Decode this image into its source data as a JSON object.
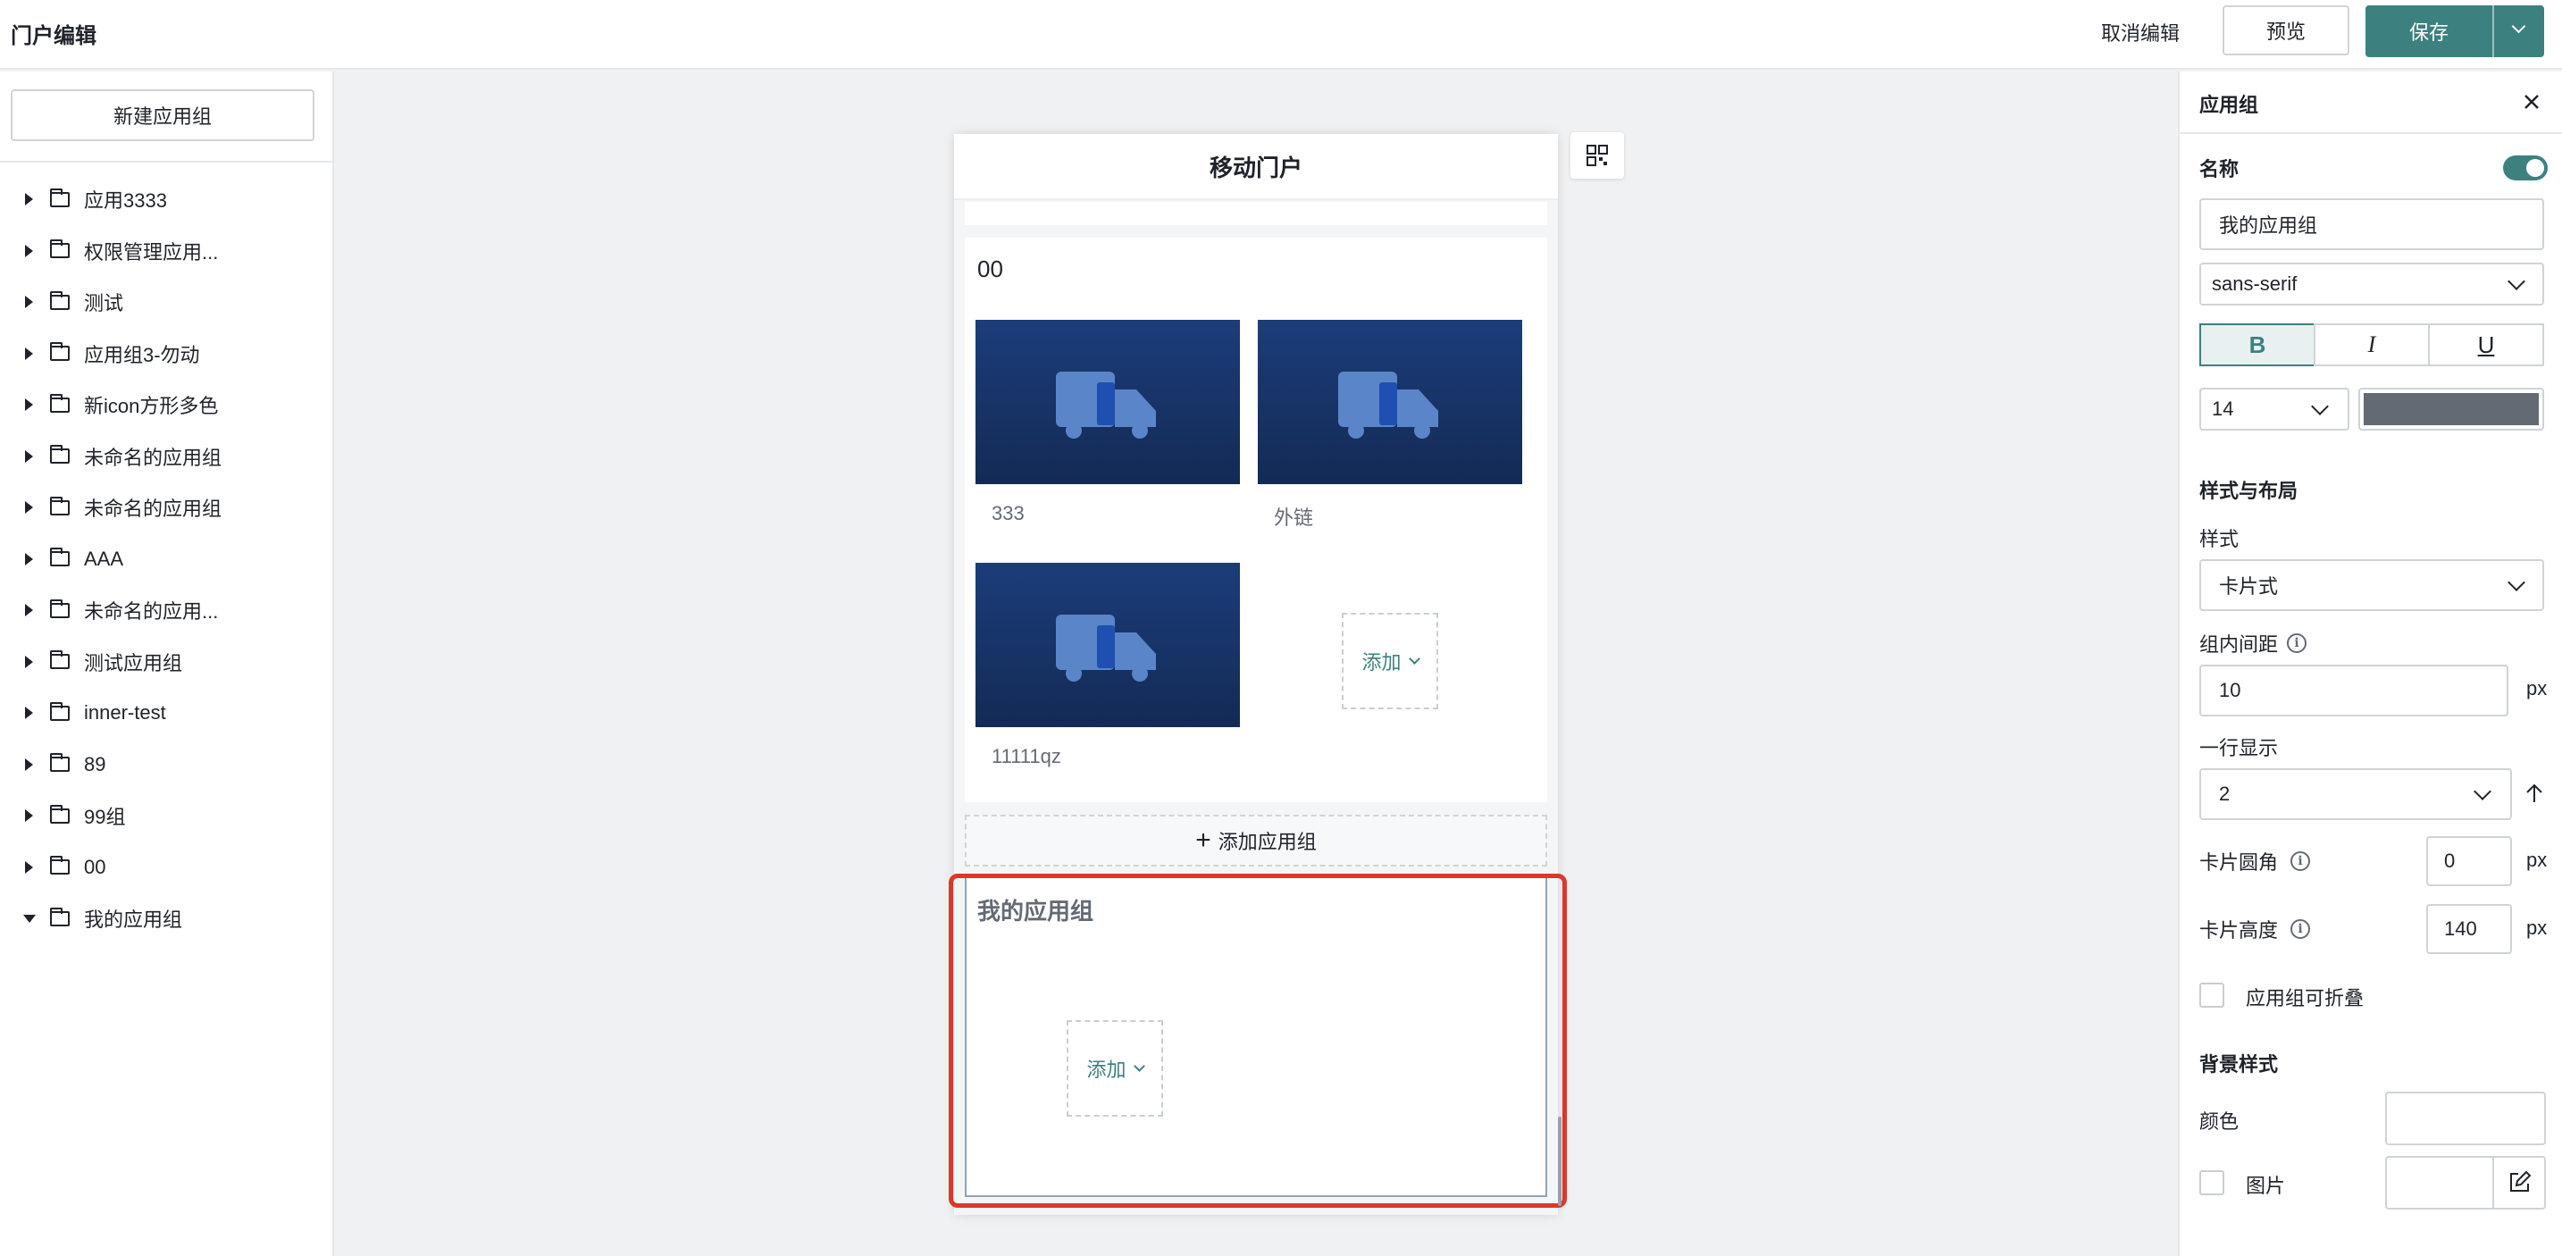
{
  "header": {
    "title": "门户编辑",
    "cancel_label": "取消编辑",
    "preview_label": "预览",
    "save_label": "保存"
  },
  "sidebar": {
    "new_group_label": "新建应用组",
    "items": [
      {
        "label": "应用3333",
        "expanded": false
      },
      {
        "label": "权限管理应用...",
        "expanded": false
      },
      {
        "label": "测试",
        "expanded": false
      },
      {
        "label": "应用组3-勿动",
        "expanded": false
      },
      {
        "label": "新icon方形多色",
        "expanded": false
      },
      {
        "label": "未命名的应用组",
        "expanded": false
      },
      {
        "label": "未命名的应用组",
        "expanded": false
      },
      {
        "label": "AAA",
        "expanded": false
      },
      {
        "label": "未命名的应用...",
        "expanded": false
      },
      {
        "label": "测试应用组",
        "expanded": false
      },
      {
        "label": "inner-test",
        "expanded": false
      },
      {
        "label": "89",
        "expanded": false
      },
      {
        "label": "99组",
        "expanded": false
      },
      {
        "label": "00",
        "expanded": false
      },
      {
        "label": "我的应用组",
        "expanded": true
      }
    ]
  },
  "canvas": {
    "phone_title": "移动门户",
    "group1": {
      "name": "00",
      "apps": [
        {
          "name": "333",
          "icon": "truck-icon"
        },
        {
          "name": "外链",
          "icon": "truck-icon"
        },
        {
          "name": "11111qz",
          "icon": "truck-icon"
        }
      ],
      "add_label": "添加"
    },
    "add_group_label": "添加应用组",
    "selected_group": {
      "name": "我的应用组",
      "add_label": "添加"
    }
  },
  "panel": {
    "title": "应用组",
    "name_label": "名称",
    "name_toggle_on": true,
    "name_value": "我的应用组",
    "font_family": "sans-serif",
    "bold_label": "B",
    "italic_label": "I",
    "underline_label": "U",
    "font_size": "14",
    "text_color": "#646a73",
    "section_style_layout": "样式与布局",
    "style_label": "样式",
    "style_value": "卡片式",
    "gap_label": "组内间距",
    "gap_value": "10",
    "px_unit": "px",
    "per_row_label": "一行显示",
    "per_row_value": "2",
    "radius_label": "卡片圆角",
    "radius_value": "0",
    "height_label": "卡片高度",
    "height_value": "140",
    "collapsible_label": "应用组可折叠",
    "section_background": "背景样式",
    "color_label": "颜色",
    "image_label": "图片"
  },
  "colors": {
    "primary": "#3d8080",
    "tile_dark": "#142a55",
    "highlight_red": "#d9392b"
  }
}
